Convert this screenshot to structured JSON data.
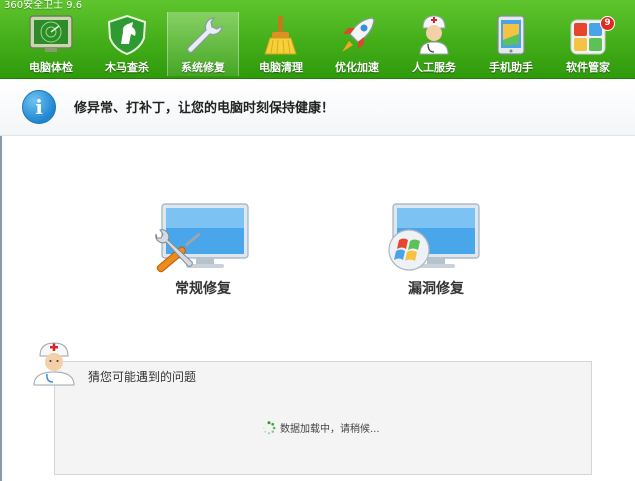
{
  "app_title": "360安全卫士 9.6",
  "toolbar": {
    "items": [
      {
        "label": "电脑体检",
        "icon": "radar-monitor-icon"
      },
      {
        "label": "木马查杀",
        "icon": "horse-shield-icon"
      },
      {
        "label": "系统修复",
        "icon": "wrench-icon",
        "active": true
      },
      {
        "label": "电脑清理",
        "icon": "broom-icon"
      },
      {
        "label": "优化加速",
        "icon": "rocket-icon"
      },
      {
        "label": "人工服务",
        "icon": "doctor-icon"
      },
      {
        "label": "手机助手",
        "icon": "phone-icon"
      },
      {
        "label": "软件管家",
        "icon": "software-box-icon",
        "badge": "9"
      }
    ]
  },
  "banner": {
    "icon": "info-icon",
    "icon_glyph": "i",
    "text": "修异常、打补丁，让您的电脑时刻保持健康！"
  },
  "options": [
    {
      "label": "常规修复",
      "icon": "monitor-tools-icon"
    },
    {
      "label": "漏洞修复",
      "icon": "monitor-windows-icon"
    }
  ],
  "issues": {
    "title": "猜您可能遇到的问题",
    "loading_text": "数据加载中，请稍候..."
  },
  "colors": {
    "toolbar_green": "#43ad19",
    "info_blue": "#1e86d1",
    "monitor_blue": "#4aa6ea"
  }
}
